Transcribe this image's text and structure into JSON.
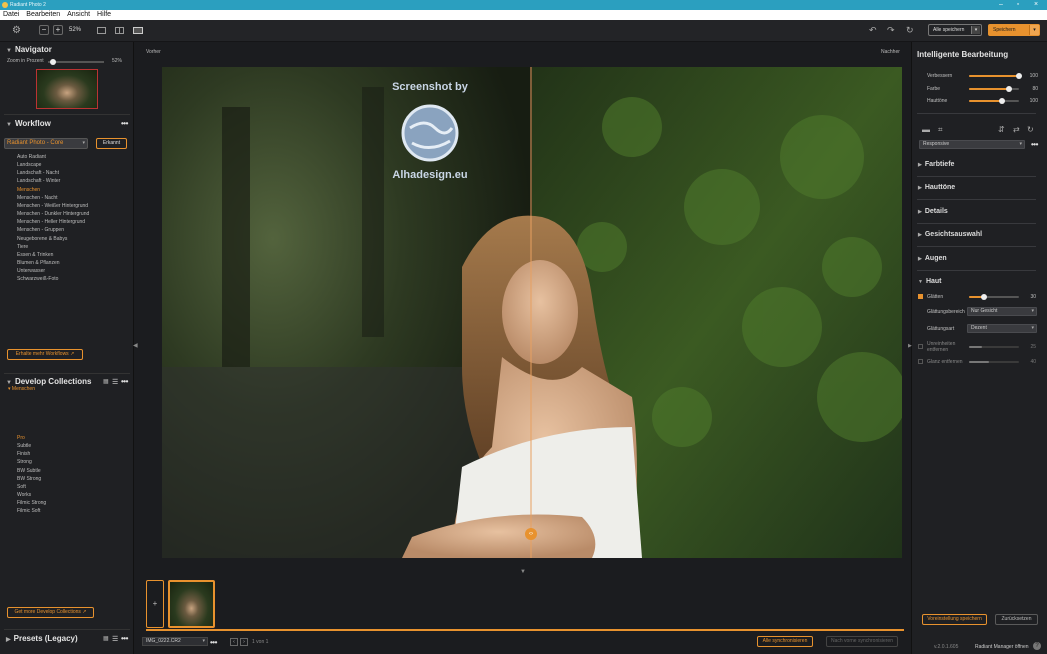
{
  "window": {
    "title": "Radiant Photo 2"
  },
  "menu": [
    "Datei",
    "Bearbeiten",
    "Ansicht",
    "Hilfe"
  ],
  "toolbar": {
    "zoom": "52%",
    "save_all": "Alle speichern",
    "save": "Speichern"
  },
  "navigator": {
    "title": "Navigator",
    "zoom_label": "Zoom in Prozent",
    "zoom_value": 0.52,
    "zoom_text": "52%"
  },
  "workflow": {
    "title": "Workflow",
    "preset_select": "Radiant Photo - Core",
    "detect_button": "Erkannt",
    "items": [
      "Auto Radiant",
      "Landscape",
      "Landschaft - Nacht",
      "Landschaft - Winter",
      "Menschen",
      "Menschen - Nacht",
      "Menschen - Weißer Hintergrund",
      "Menschen - Dunkler Hintergrund",
      "Menschen - Heller Hintergrund",
      "Menschen - Gruppen",
      "Neugeborene & Babys",
      "Tiere",
      "Essen & Trinken",
      "Blumen & Pflanzen",
      "Unterwasser",
      "Schwarzweiß-Foto"
    ],
    "selected_index": 4,
    "more_button": "Erhalte mehr Workflows"
  },
  "collections": {
    "title": "Develop Collections",
    "group": "Menschen",
    "items": [
      "Pro",
      "Subtle",
      "Finish",
      "Strong",
      "BW Subtle",
      "BW Strong",
      "Soft",
      "Works",
      "Filmic Strong",
      "Filmic Soft"
    ],
    "selected_index": 0,
    "more_button": "Get more Develop Collections"
  },
  "presets": {
    "title": "Presets (Legacy)"
  },
  "view": {
    "before": "Vorher",
    "after": "Nachher"
  },
  "watermark": {
    "line1": "Screenshot by",
    "line2": "Alhadesign.eu"
  },
  "filmstrip": {
    "filename": "IMG_0222.CR2",
    "counter": "1 von 1",
    "sync_all": "Alle synchronisieren",
    "sync_selected": "Nach vorne synchronisieren"
  },
  "right": {
    "title": "Intelligente Bearbeitung",
    "sliders": [
      {
        "label": "Verbessern",
        "value": 100,
        "frac": 1.0
      },
      {
        "label": "Farbe",
        "value": 80,
        "frac": 0.8
      },
      {
        "label": "Hauttöne",
        "value": 100,
        "frac": 0.65
      }
    ],
    "responsive": "Responsive",
    "panels": [
      "Farbtiefe",
      "Hauttöne",
      "Details",
      "Gesichtsauswahl",
      "Augen"
    ],
    "haut": {
      "title": "Haut",
      "smooth_label": "Glätten",
      "smooth_value": 30,
      "smooth_frac": 0.3,
      "area_label": "Glättungsbereich",
      "area_value": "Nur Gesicht",
      "type_label": "Glättungsart",
      "type_value": "Dezent",
      "blemish_label_1": "Unreinheiten",
      "blemish_label_2": "entfernen",
      "blemish_value": 25,
      "blemish_frac": 0.25,
      "shine_label": "Glanz entfernen",
      "shine_value": 40,
      "shine_frac": 0.4
    },
    "save_preset": "Voreinstellung speichern",
    "reset": "Zurücksetzen"
  },
  "status": {
    "version": "v.2.0.1.605",
    "manager": "Radiant Manager öffnen"
  },
  "colors": {
    "accent": "#e8922e",
    "titlebar": "#2b9fbf"
  }
}
